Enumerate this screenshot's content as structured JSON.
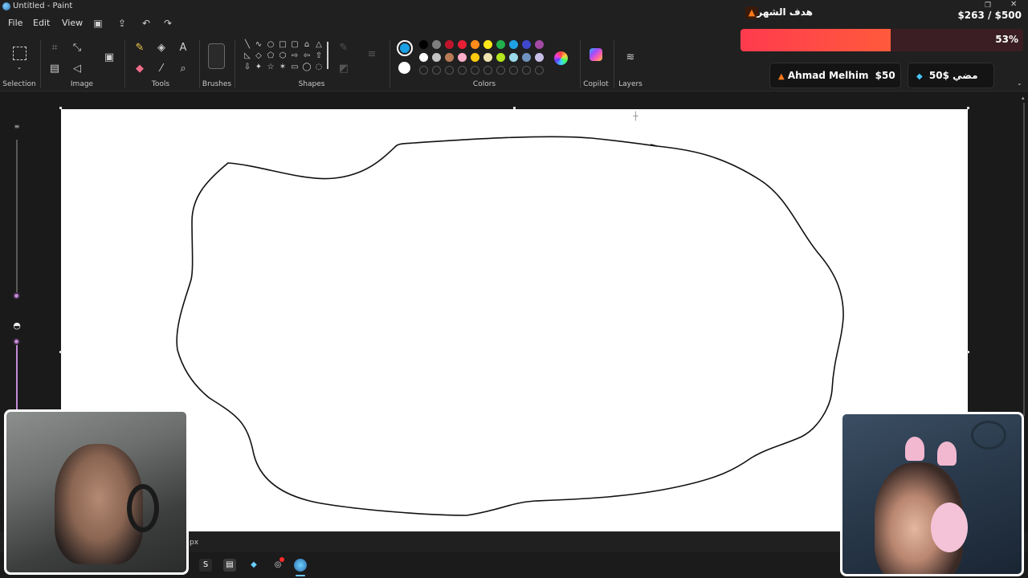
{
  "window": {
    "title": "Untitled - Paint"
  },
  "menu": {
    "file": "File",
    "edit": "Edit",
    "view": "View"
  },
  "ribbon": {
    "groups": {
      "selection": "Selection",
      "image": "Image",
      "tools": "Tools",
      "brushes": "Brushes",
      "shapes": "Shapes",
      "colors": "Colors",
      "copilot": "Copilot",
      "layers": "Layers"
    },
    "primary_color": "#1aa0e6",
    "secondary_color": "#ffffff",
    "palette_row1": [
      "#000000",
      "#7f7f7f",
      "#c0142c",
      "#e81f36",
      "#ff8c1a",
      "#ffe81a",
      "#22b14c",
      "#1fa2e5",
      "#3f48cc",
      "#a349a4"
    ],
    "palette_row2": [
      "#ffffff",
      "#c3c3c3",
      "#b97a57",
      "#ffaec9",
      "#ffc90e",
      "#efe4b0",
      "#b5e61d",
      "#99d9ea",
      "#7092be",
      "#c8bfe7"
    ]
  },
  "status": {
    "size_unit": "px"
  },
  "overlay": {
    "goal_title": "هدف الشهر",
    "goal_amount": "$263 / $500",
    "goal_percent": "53%",
    "goal_progress": 0.53,
    "donors": [
      {
        "name": "Ahmad Melhim",
        "amount": "$50",
        "icon": "fire-icon"
      },
      {
        "name": "مضي",
        "amount": "$50",
        "icon": "diamond-icon"
      }
    ]
  }
}
